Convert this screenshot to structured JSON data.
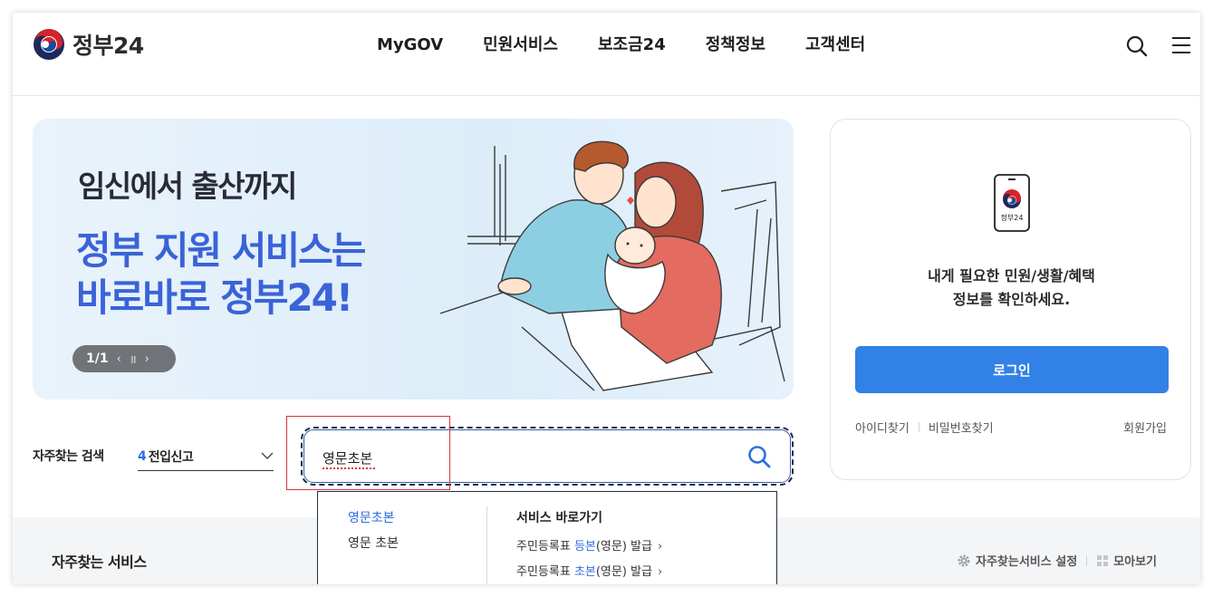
{
  "header": {
    "logo_text": "정부24",
    "nav": [
      "MyGOV",
      "민원서비스",
      "보조금24",
      "정책정보",
      "고객센터"
    ]
  },
  "banner": {
    "subtitle": "임신에서 출산까지",
    "headline_line1": "정부 지원 서비스는",
    "headline_line2": "바로바로 정부24!",
    "pager": "1/1",
    "prev": "‹",
    "pause": "॥",
    "next": "›"
  },
  "login": {
    "app_label": "정부24",
    "message_line1": "내게 필요한 민원/생활/혜택",
    "message_line2": "정보를 확인하세요.",
    "login_button": "로그인",
    "find_id": "아이디찾기",
    "find_pw": "비밀번호찾기",
    "signup": "회원가입"
  },
  "popular": {
    "label": "자주찾는 검색",
    "rank": "4",
    "value": "전입신고"
  },
  "search": {
    "value": "영문초본"
  },
  "autocomplete": {
    "suggestions": [
      "영문초본",
      "영문 초본"
    ],
    "shortcut_title": "서비스 바로가기",
    "links": [
      {
        "prefix": "주민등록표 ",
        "highlight": "등본",
        "suffix": "(영문) 발급",
        "arrow": "›"
      },
      {
        "prefix": "주민등록표 ",
        "highlight": "초본",
        "suffix": "(영문) 발급",
        "arrow": "›"
      }
    ]
  },
  "bottom": {
    "title": "자주찾는 서비스",
    "settings": "자주찾는서비스 설정",
    "view_all": "모아보기"
  },
  "colors": {
    "primary": "#3281e6",
    "banner_headline": "#3a63d8",
    "highlight_link": "#2f6fe0",
    "annotation_box": "#d1343d"
  }
}
